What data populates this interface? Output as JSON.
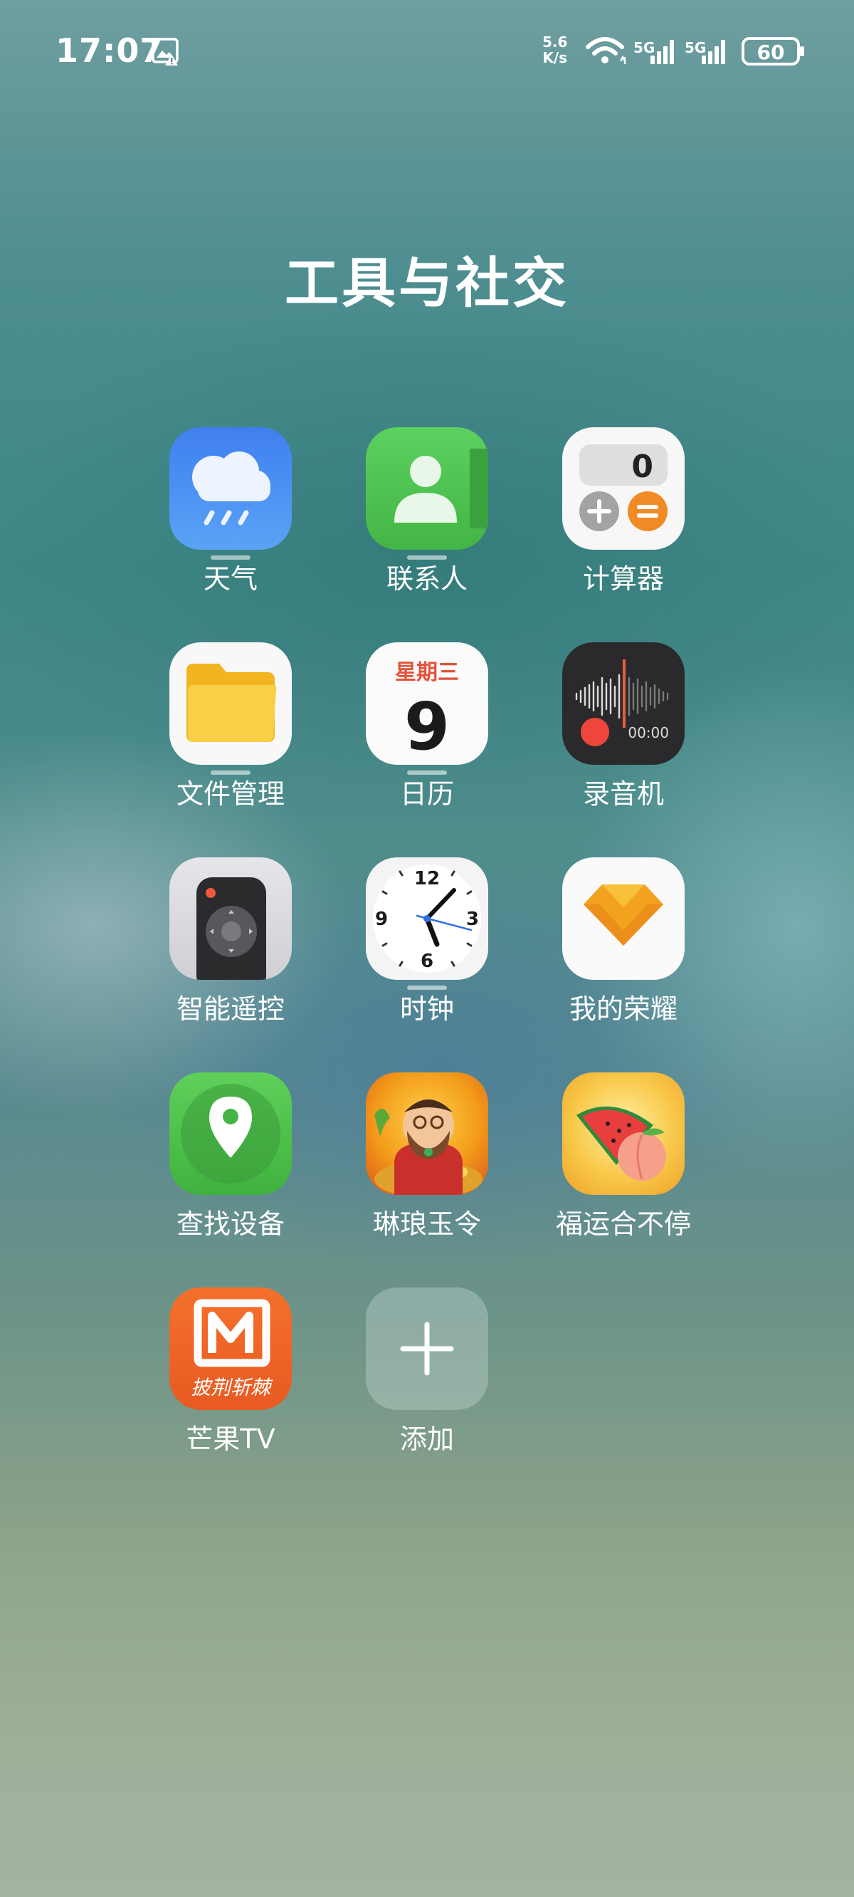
{
  "status_bar": {
    "time": "17:07",
    "network_speed_value": "5.6",
    "network_speed_unit": "K/s",
    "signal1_label": "5G",
    "signal2_label": "5G",
    "battery": "60"
  },
  "folder": {
    "title": "工具与社交"
  },
  "apps": [
    {
      "label": "天气",
      "icon": "weather-icon"
    },
    {
      "label": "联系人",
      "icon": "contacts-icon"
    },
    {
      "label": "计算器",
      "icon": "calculator-icon",
      "display": "0"
    },
    {
      "label": "文件管理",
      "icon": "files-icon"
    },
    {
      "label": "日历",
      "icon": "calendar-icon",
      "weekday": "星期三",
      "day": "9"
    },
    {
      "label": "录音机",
      "icon": "recorder-icon",
      "timer": "00:00"
    },
    {
      "label": "智能遥控",
      "icon": "remote-icon"
    },
    {
      "label": "时钟",
      "icon": "clock-icon"
    },
    {
      "label": "我的荣耀",
      "icon": "honor-icon"
    },
    {
      "label": "查找设备",
      "icon": "find-device-icon"
    },
    {
      "label": "琳琅玉令",
      "icon": "game-icon"
    },
    {
      "label": "福运合不停",
      "icon": "fruit-game-icon"
    },
    {
      "label": "芒果TV",
      "icon": "mango-tv-icon",
      "tagline": "披荆斩棘"
    },
    {
      "label": "添加",
      "icon": "add-icon"
    }
  ],
  "clock_numbers": {
    "n12": "12",
    "n3": "3",
    "n6": "6",
    "n9": "9"
  },
  "colors": {
    "weather": "#4d8ef2",
    "contacts": "#4cc44f",
    "calendar_header": "#e4523a",
    "recorder_accent": "#f05a3c",
    "honor": "#f6a623",
    "mango": "#f06a2a"
  }
}
